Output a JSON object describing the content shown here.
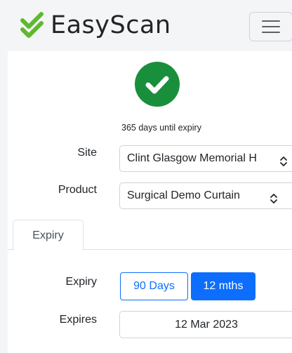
{
  "app": {
    "brand_name": "EasyScan",
    "brand_icon": "double-check-icon",
    "brand_color": "#5fb830",
    "menu_icon": "hamburger-icon"
  },
  "status": {
    "icon": "check-icon",
    "color": "#198f3c",
    "text": "365 days until expiry"
  },
  "form": {
    "site_label": "Site",
    "site_value": "Clint Glasgow Memorial H",
    "product_label": "Product",
    "product_value": "Surgical Demo Curtain"
  },
  "tabs": [
    {
      "label": "Expiry",
      "active": true
    }
  ],
  "expiry": {
    "label": "Expiry",
    "options": [
      {
        "label": "90 Days",
        "selected": false
      },
      {
        "label": "12 mths",
        "selected": true
      }
    ],
    "expires_label": "Expires",
    "expires_value": "12 Mar 2023"
  },
  "colors": {
    "accent": "#0d6efd",
    "success": "#198f3c"
  }
}
